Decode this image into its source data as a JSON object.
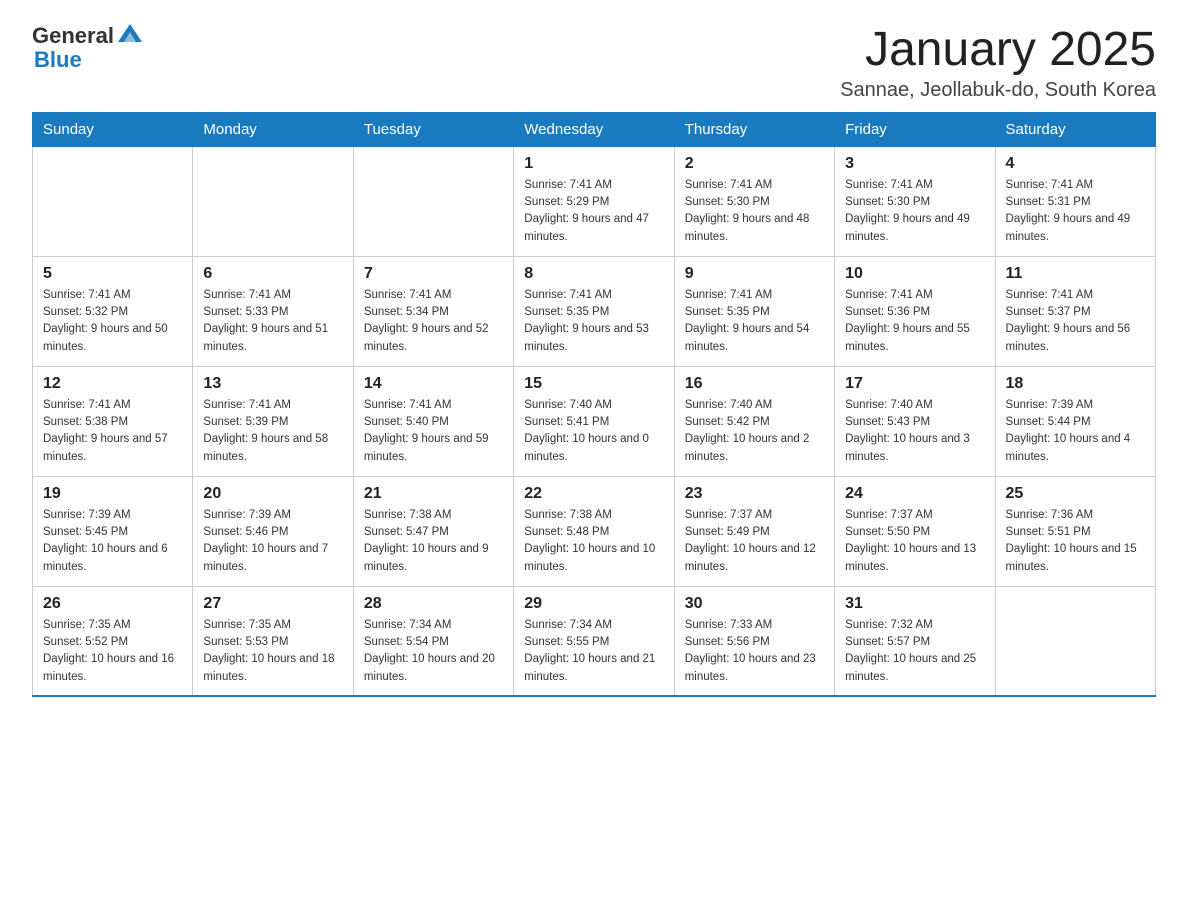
{
  "logo": {
    "general": "General",
    "blue": "Blue"
  },
  "title": "January 2025",
  "location": "Sannae, Jeollabuk-do, South Korea",
  "days_of_week": [
    "Sunday",
    "Monday",
    "Tuesday",
    "Wednesday",
    "Thursday",
    "Friday",
    "Saturday"
  ],
  "weeks": [
    [
      {
        "day": "",
        "info": ""
      },
      {
        "day": "",
        "info": ""
      },
      {
        "day": "",
        "info": ""
      },
      {
        "day": "1",
        "info": "Sunrise: 7:41 AM\nSunset: 5:29 PM\nDaylight: 9 hours and 47 minutes."
      },
      {
        "day": "2",
        "info": "Sunrise: 7:41 AM\nSunset: 5:30 PM\nDaylight: 9 hours and 48 minutes."
      },
      {
        "day": "3",
        "info": "Sunrise: 7:41 AM\nSunset: 5:30 PM\nDaylight: 9 hours and 49 minutes."
      },
      {
        "day": "4",
        "info": "Sunrise: 7:41 AM\nSunset: 5:31 PM\nDaylight: 9 hours and 49 minutes."
      }
    ],
    [
      {
        "day": "5",
        "info": "Sunrise: 7:41 AM\nSunset: 5:32 PM\nDaylight: 9 hours and 50 minutes."
      },
      {
        "day": "6",
        "info": "Sunrise: 7:41 AM\nSunset: 5:33 PM\nDaylight: 9 hours and 51 minutes."
      },
      {
        "day": "7",
        "info": "Sunrise: 7:41 AM\nSunset: 5:34 PM\nDaylight: 9 hours and 52 minutes."
      },
      {
        "day": "8",
        "info": "Sunrise: 7:41 AM\nSunset: 5:35 PM\nDaylight: 9 hours and 53 minutes."
      },
      {
        "day": "9",
        "info": "Sunrise: 7:41 AM\nSunset: 5:35 PM\nDaylight: 9 hours and 54 minutes."
      },
      {
        "day": "10",
        "info": "Sunrise: 7:41 AM\nSunset: 5:36 PM\nDaylight: 9 hours and 55 minutes."
      },
      {
        "day": "11",
        "info": "Sunrise: 7:41 AM\nSunset: 5:37 PM\nDaylight: 9 hours and 56 minutes."
      }
    ],
    [
      {
        "day": "12",
        "info": "Sunrise: 7:41 AM\nSunset: 5:38 PM\nDaylight: 9 hours and 57 minutes."
      },
      {
        "day": "13",
        "info": "Sunrise: 7:41 AM\nSunset: 5:39 PM\nDaylight: 9 hours and 58 minutes."
      },
      {
        "day": "14",
        "info": "Sunrise: 7:41 AM\nSunset: 5:40 PM\nDaylight: 9 hours and 59 minutes."
      },
      {
        "day": "15",
        "info": "Sunrise: 7:40 AM\nSunset: 5:41 PM\nDaylight: 10 hours and 0 minutes."
      },
      {
        "day": "16",
        "info": "Sunrise: 7:40 AM\nSunset: 5:42 PM\nDaylight: 10 hours and 2 minutes."
      },
      {
        "day": "17",
        "info": "Sunrise: 7:40 AM\nSunset: 5:43 PM\nDaylight: 10 hours and 3 minutes."
      },
      {
        "day": "18",
        "info": "Sunrise: 7:39 AM\nSunset: 5:44 PM\nDaylight: 10 hours and 4 minutes."
      }
    ],
    [
      {
        "day": "19",
        "info": "Sunrise: 7:39 AM\nSunset: 5:45 PM\nDaylight: 10 hours and 6 minutes."
      },
      {
        "day": "20",
        "info": "Sunrise: 7:39 AM\nSunset: 5:46 PM\nDaylight: 10 hours and 7 minutes."
      },
      {
        "day": "21",
        "info": "Sunrise: 7:38 AM\nSunset: 5:47 PM\nDaylight: 10 hours and 9 minutes."
      },
      {
        "day": "22",
        "info": "Sunrise: 7:38 AM\nSunset: 5:48 PM\nDaylight: 10 hours and 10 minutes."
      },
      {
        "day": "23",
        "info": "Sunrise: 7:37 AM\nSunset: 5:49 PM\nDaylight: 10 hours and 12 minutes."
      },
      {
        "day": "24",
        "info": "Sunrise: 7:37 AM\nSunset: 5:50 PM\nDaylight: 10 hours and 13 minutes."
      },
      {
        "day": "25",
        "info": "Sunrise: 7:36 AM\nSunset: 5:51 PM\nDaylight: 10 hours and 15 minutes."
      }
    ],
    [
      {
        "day": "26",
        "info": "Sunrise: 7:35 AM\nSunset: 5:52 PM\nDaylight: 10 hours and 16 minutes."
      },
      {
        "day": "27",
        "info": "Sunrise: 7:35 AM\nSunset: 5:53 PM\nDaylight: 10 hours and 18 minutes."
      },
      {
        "day": "28",
        "info": "Sunrise: 7:34 AM\nSunset: 5:54 PM\nDaylight: 10 hours and 20 minutes."
      },
      {
        "day": "29",
        "info": "Sunrise: 7:34 AM\nSunset: 5:55 PM\nDaylight: 10 hours and 21 minutes."
      },
      {
        "day": "30",
        "info": "Sunrise: 7:33 AM\nSunset: 5:56 PM\nDaylight: 10 hours and 23 minutes."
      },
      {
        "day": "31",
        "info": "Sunrise: 7:32 AM\nSunset: 5:57 PM\nDaylight: 10 hours and 25 minutes."
      },
      {
        "day": "",
        "info": ""
      }
    ]
  ]
}
